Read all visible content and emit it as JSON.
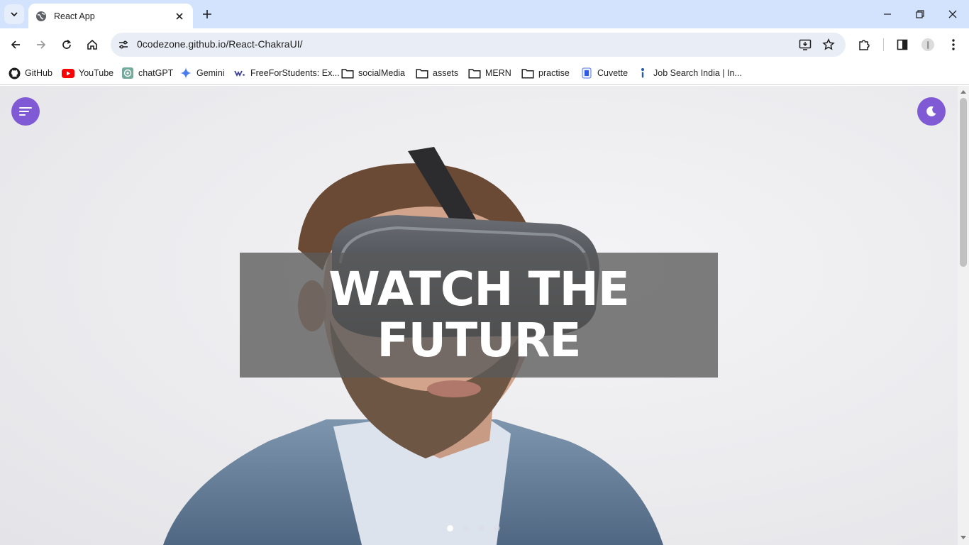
{
  "browser": {
    "tab": {
      "title": "React App"
    },
    "address": {
      "url": "0codezone.github.io/React-ChakraUI/"
    },
    "bookmarks": [
      {
        "label": "GitHub",
        "icon": "github-icon"
      },
      {
        "label": "YouTube",
        "icon": "youtube-icon"
      },
      {
        "label": "chatGPT",
        "icon": "chatgpt-icon"
      },
      {
        "label": "Gemini",
        "icon": "gemini-icon"
      },
      {
        "label": "FreeForStudents: Ex...",
        "icon": "freeforstudents-icon"
      },
      {
        "label": "socialMedia",
        "icon": "folder-icon"
      },
      {
        "label": "assets",
        "icon": "folder-icon"
      },
      {
        "label": "MERN",
        "icon": "folder-icon"
      },
      {
        "label": "practise",
        "icon": "folder-icon"
      },
      {
        "label": "Cuvette",
        "icon": "cuvette-icon"
      },
      {
        "label": "Job Search India | In...",
        "icon": "indeed-icon"
      }
    ]
  },
  "page": {
    "menu_button_icon": "menu-lines-icon",
    "theme_toggle_icon": "moon-icon",
    "hero": {
      "title": "WATCH THE FUTURE"
    },
    "carousel": {
      "slide_count": 4,
      "active_index": 0
    }
  },
  "colors": {
    "accent": "#805ad5",
    "tabstrip": "#d3e3fd",
    "overlay": "rgba(90,90,90,0.78)"
  }
}
